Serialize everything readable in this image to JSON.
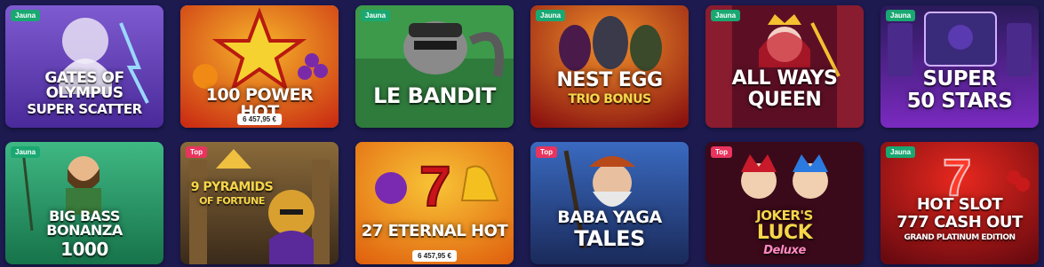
{
  "games": [
    {
      "title": [
        "GATES OF OLYMPUS",
        "SUPER SCATTER"
      ],
      "badge": "Jauna",
      "badge_type": "new",
      "jackpot": "",
      "bg": "#6b3fb8",
      "accent": "#b08be0"
    },
    {
      "title": [
        "100 POWER HOT"
      ],
      "badge": "",
      "badge_type": "",
      "jackpot": "6 457,95 €",
      "bg": "#d63a17",
      "accent": "#f4c020"
    },
    {
      "title": [
        "LE BANDIT"
      ],
      "badge": "Jauna",
      "badge_type": "new",
      "jackpot": "",
      "bg": "#2e7a38",
      "accent": "#8fc27a"
    },
    {
      "title": [
        "NEST EGG",
        "TRIO BONUS"
      ],
      "badge": "Jauna",
      "badge_type": "new",
      "jackpot": "",
      "bg": "#b3211a",
      "accent": "#f07a22"
    },
    {
      "title": [
        "ALL WAYS",
        "QUEEN"
      ],
      "badge": "Jauna",
      "badge_type": "new",
      "jackpot": "",
      "bg": "#7a1732",
      "accent": "#e04a7a"
    },
    {
      "title": [
        "SUPER",
        "50 STARS"
      ],
      "badge": "Jauna",
      "badge_type": "new",
      "jackpot": "",
      "bg": "#4a1c8c",
      "accent": "#9a5ae0"
    },
    {
      "title": [
        "BIG BASS BONANZA",
        "1000"
      ],
      "badge": "Jauna",
      "badge_type": "new",
      "jackpot": "",
      "bg": "#1f8a5c",
      "accent": "#5ad08e"
    },
    {
      "title": [
        "9 PYRAMIDS",
        "OF FORTUNE"
      ],
      "badge": "Top",
      "badge_type": "top",
      "jackpot": "",
      "bg": "#6a4a2a",
      "accent": "#d9a44a"
    },
    {
      "title": [
        "27 ETERNAL HOT"
      ],
      "badge": "",
      "badge_type": "",
      "jackpot": "6 457,95 €",
      "bg": "#e07a14",
      "accent": "#f6c632"
    },
    {
      "title": [
        "BABA YAGA",
        "TALES"
      ],
      "badge": "Top",
      "badge_type": "top",
      "jackpot": "",
      "bg": "#2a4a8a",
      "accent": "#6aa0e0"
    },
    {
      "title": [
        "JOKER'S",
        "LUCK",
        "Deluxe"
      ],
      "badge": "Top",
      "badge_type": "top",
      "jackpot": "",
      "bg": "#4a0f24",
      "accent": "#e03a3a"
    },
    {
      "title": [
        "HOT SLOT",
        "777 CASH OUT",
        "GRAND PLATINUM EDITION"
      ],
      "badge": "Jauna",
      "badge_type": "new",
      "jackpot": "",
      "bg": "#a0141a",
      "accent": "#f0402a"
    }
  ]
}
